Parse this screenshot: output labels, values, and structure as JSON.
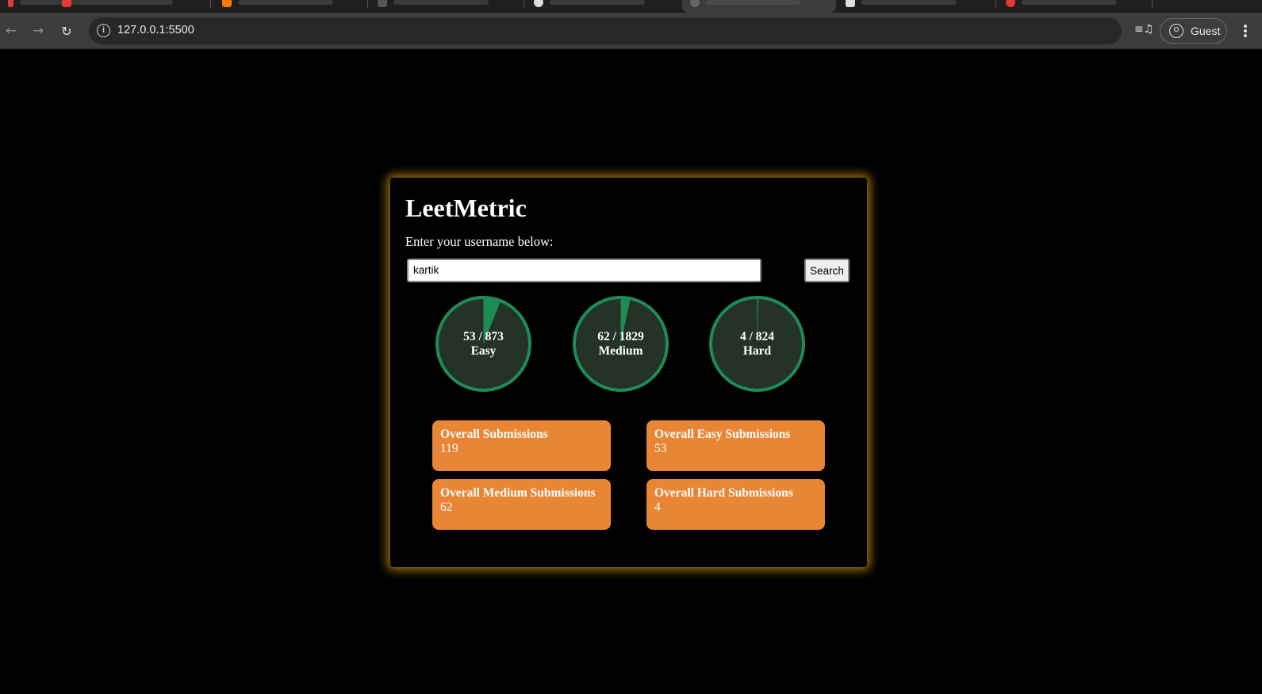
{
  "browser": {
    "url": "127.0.0.1:5500",
    "profile_label": "Guest"
  },
  "app": {
    "title": "LeetMetric",
    "prompt": "Enter your username below:",
    "search_value": "kartik",
    "search_button_label": "Search"
  },
  "progress": [
    {
      "solved": 53,
      "total": 873,
      "ratio_text": "53 / 873",
      "label": "Easy"
    },
    {
      "solved": 62,
      "total": 1829,
      "ratio_text": "62 / 1829",
      "label": "Medium"
    },
    {
      "solved": 4,
      "total": 824,
      "ratio_text": "4 / 824",
      "label": "Hard"
    }
  ],
  "stats": [
    {
      "title": "Overall Submissions",
      "value": "119"
    },
    {
      "title": "Overall Easy Submissions",
      "value": "53"
    },
    {
      "title": "Overall Medium Submissions",
      "value": "62"
    },
    {
      "title": "Overall Hard Submissions",
      "value": "4"
    }
  ],
  "colors": {
    "progress_fill": "#1e8c55",
    "circle_bg": "#243228",
    "stat_card": "#e88635",
    "card_glow": "#d49614"
  }
}
